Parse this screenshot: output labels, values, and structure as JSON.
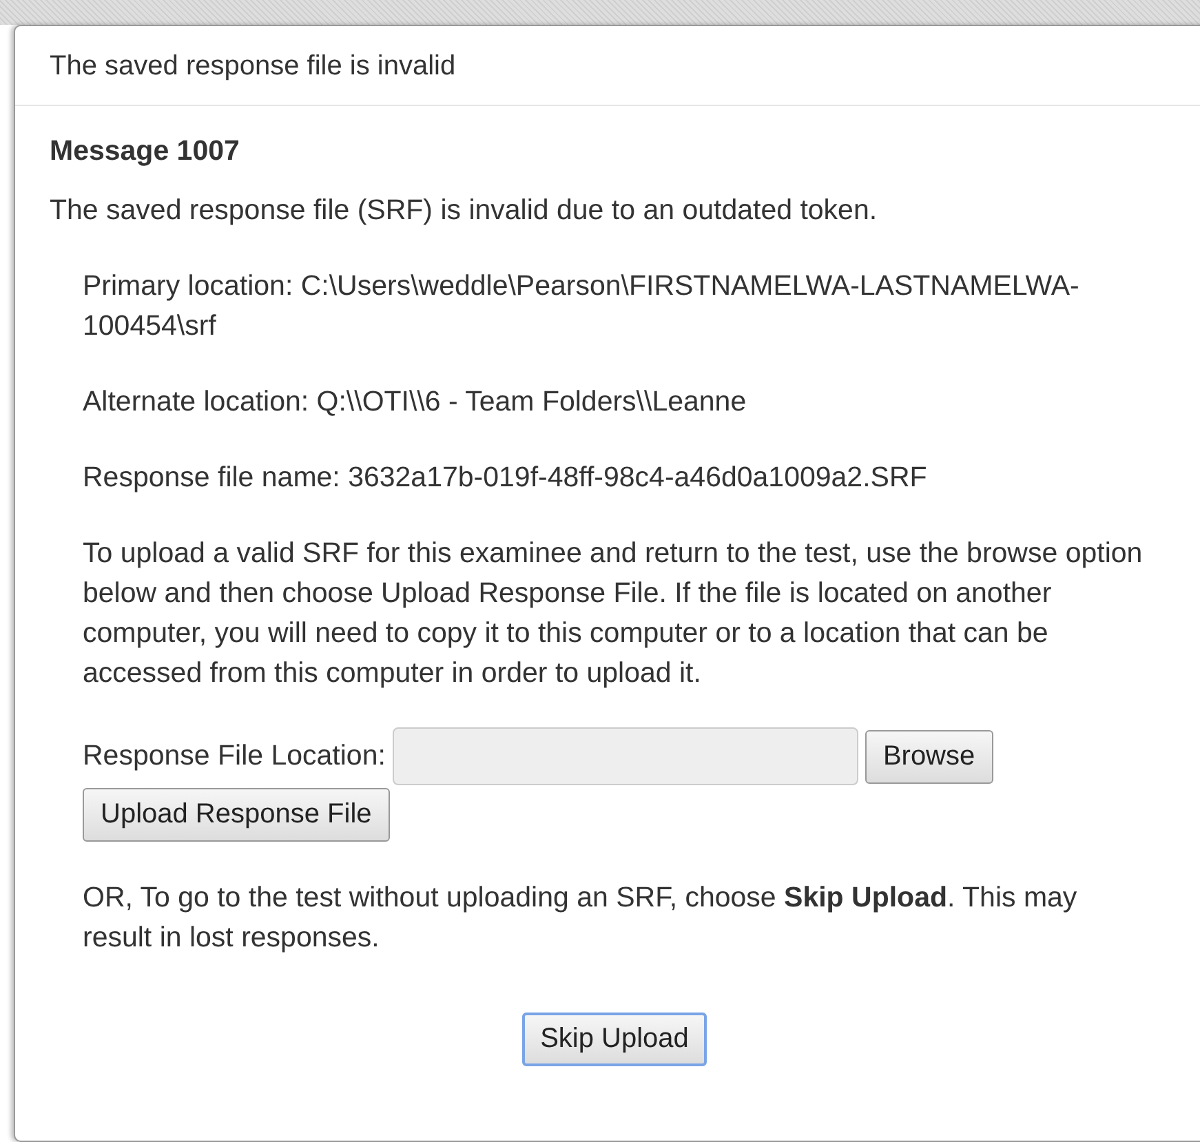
{
  "dialog": {
    "title": "The saved response file is invalid"
  },
  "message_heading": "Message 1007",
  "intro": "The saved response file (SRF) is invalid due to an outdated token.",
  "details": [
    "Primary location: C:\\Users\\weddle\\Pearson\\FIRSTNAMELWA-LASTNAMELWA-100454\\srf",
    "Alternate location: Q:\\\\OTI\\\\6 - Team Folders\\\\Leanne",
    "Response file name: 3632a17b-019f-48ff-98c4-a46d0a1009a2.SRF",
    "To upload a valid SRF for this examinee and return to the test, use the browse option below and then choose Upload Response File. If the file is located on another computer, you will need to copy it to this computer or to a location that can be accessed from this computer in order to upload it."
  ],
  "upload": {
    "label": "Response File Location:",
    "browse_button": "Browse",
    "upload_button": "Upload Response File"
  },
  "skip_note": "OR, To go to the test without uploading an SRF, choose **Skip Upload**. This may result in lost responses.",
  "skip_button": {
    "label": "Skip Upload",
    "focused": true
  }
}
